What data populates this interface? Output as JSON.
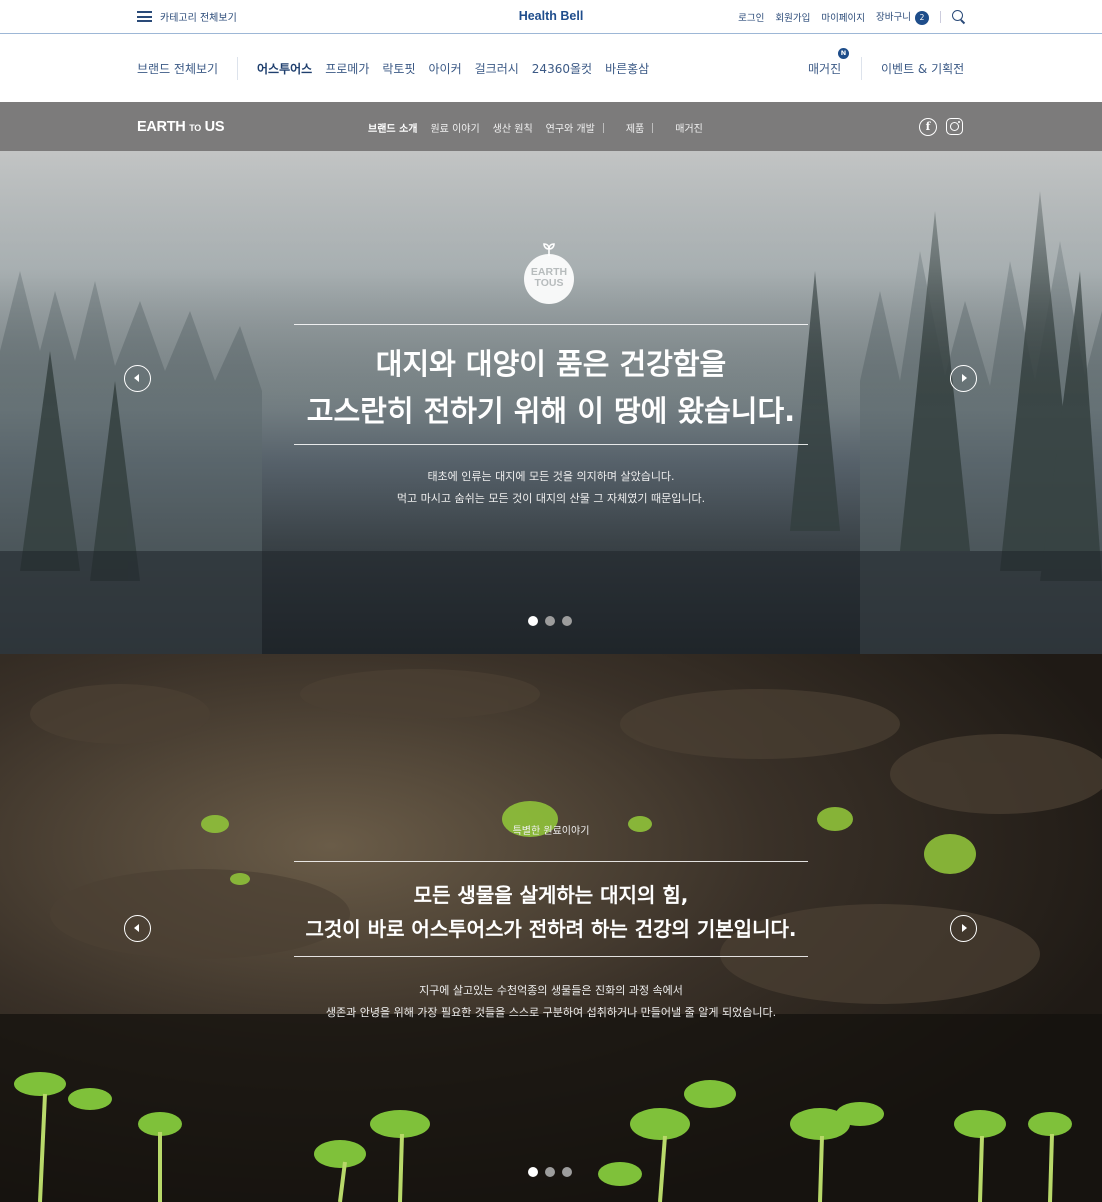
{
  "topbar": {
    "category_all": "카테고리 전체보기",
    "logo": "Health Bell",
    "login": "로그인",
    "signup": "회원가입",
    "mypage": "마이페이지",
    "cart": "장바구니",
    "cart_count": "2"
  },
  "brandnav": {
    "all": "브랜드 전체보기",
    "brands": [
      "어스투어스",
      "프로메가",
      "락토핏",
      "아이커",
      "걸크러시",
      "24360올컷",
      "바른홍삼"
    ],
    "active_brand": "어스투어스",
    "magazine": "매거진",
    "magazine_badge": "N",
    "event": "이벤트 & 기획전"
  },
  "brandbar": {
    "logo_main": "EARTH",
    "logo_to": "TO",
    "logo_us": "US",
    "nav": [
      "브랜드 소개",
      "원료 이야기",
      "생산 원칙",
      "연구와 개발"
    ],
    "products": "제품",
    "magazine": "매거진",
    "active": "브랜드 소개"
  },
  "hero1": {
    "emblem_line1": "EARTH",
    "emblem_line2": "TOUS",
    "headline_line1": "대지와 대양이 품은 건강함을",
    "headline_line2": "고스란히 전하기 위해 이 땅에 왔습니다.",
    "sub_line1": "태초에 인류는 대지에 모든 것을 의지하며 살았습니다.",
    "sub_line2": "먹고 마시고 숨쉬는 모든 것이 대지의 산물 그 자체였기 때문입니다.",
    "slides": 3,
    "active_slide": 1
  },
  "hero2": {
    "eyebrow": "특별한 원료이야기",
    "headline_line1": "모든 생물을 살게하는 대지의 힘,",
    "headline_line2": "그것이 바로 어스투어스가 전하려 하는 건강의 기본입니다.",
    "sub_line1": "지구에 살고있는 수천억종의 생물들은 진화의 과정 속에서",
    "sub_line2": "생존과 안녕을 위해 가장 필요한 것들을 스스로 구분하여 섭취하거나 만들어낼 줄 알게 되었습니다.",
    "slides": 3,
    "active_slide": 1
  },
  "colors": {
    "brand_blue": "#1f4d8c",
    "gray_bar": "#7c7b7b"
  }
}
